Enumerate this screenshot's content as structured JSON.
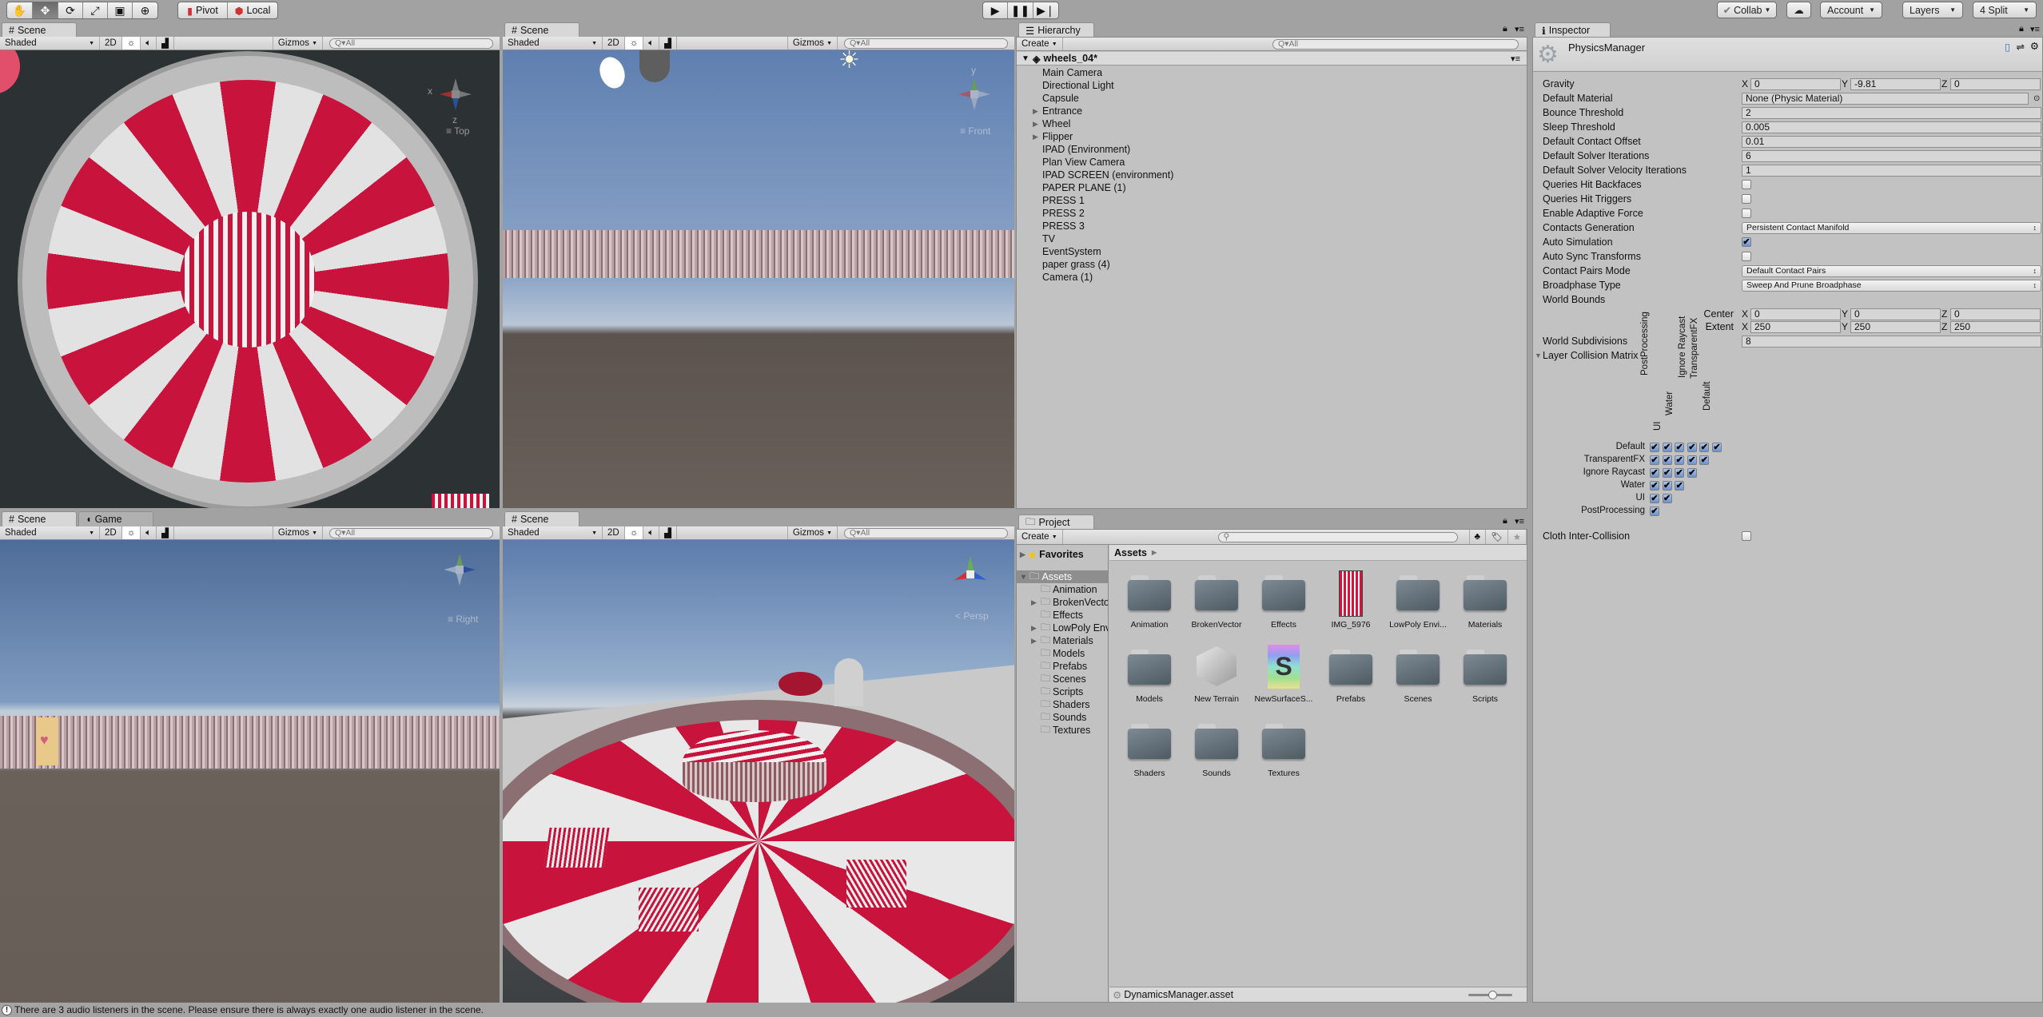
{
  "toolbar": {
    "tools": [
      "hand-icon",
      "move-icon",
      "rotate-icon",
      "scale-icon",
      "rect-icon",
      "transform-icon"
    ],
    "pivot_label": "Pivot",
    "local_label": "Local",
    "collab_label": "Collab",
    "account_label": "Account",
    "layers_label": "Layers",
    "layout_label": "4 Split"
  },
  "views": {
    "scene_tab": "Scene",
    "game_tab": "Game",
    "shading": "Shaded",
    "mode_2d": "2D",
    "gizmos": "Gizmos",
    "search_placeholder": "All",
    "top_left_orientation": "Top",
    "top_right_orientation": "Front",
    "bottom_left_orientation": "Right",
    "bottom_right_orientation": "Persp",
    "axis_x": "x",
    "axis_y": "y",
    "axis_z": "z"
  },
  "hierarchy": {
    "tab": "Hierarchy",
    "create": "Create",
    "search_placeholder": "All",
    "scene_name": "wheels_04*",
    "items": [
      {
        "label": "Main Camera",
        "expandable": false
      },
      {
        "label": "Directional Light",
        "expandable": false
      },
      {
        "label": "Capsule",
        "expandable": false
      },
      {
        "label": "Entrance",
        "expandable": true
      },
      {
        "label": "Wheel",
        "expandable": true
      },
      {
        "label": "Flipper",
        "expandable": true
      },
      {
        "label": "IPAD (Environment)",
        "expandable": false
      },
      {
        "label": "Plan View Camera",
        "expandable": false
      },
      {
        "label": "IPAD SCREEN (environment)",
        "expandable": false
      },
      {
        "label": "PAPER PLANE (1)",
        "expandable": false
      },
      {
        "label": "PRESS 1",
        "expandable": false
      },
      {
        "label": "PRESS 2",
        "expandable": false
      },
      {
        "label": "PRESS 3",
        "expandable": false
      },
      {
        "label": "TV",
        "expandable": false
      },
      {
        "label": "EventSystem",
        "expandable": false
      },
      {
        "label": "paper grass (4)",
        "expandable": false
      },
      {
        "label": "Camera (1)",
        "expandable": false
      }
    ]
  },
  "inspector": {
    "tab": "Inspector",
    "title": "PhysicsManager",
    "gravity": {
      "label": "Gravity",
      "x": "0",
      "y": "-9.81",
      "z": "0"
    },
    "fields": [
      {
        "label": "Default Material",
        "type": "object",
        "value": "None (Physic Material)"
      },
      {
        "label": "Bounce Threshold",
        "type": "text",
        "value": "2"
      },
      {
        "label": "Sleep Threshold",
        "type": "text",
        "value": "0.005"
      },
      {
        "label": "Default Contact Offset",
        "type": "text",
        "value": "0.01"
      },
      {
        "label": "Default Solver Iterations",
        "type": "text",
        "value": "6"
      },
      {
        "label": "Default Solver Velocity Iterations",
        "type": "text",
        "value": "1"
      },
      {
        "label": "Queries Hit Backfaces",
        "type": "check",
        "value": false
      },
      {
        "label": "Queries Hit Triggers",
        "type": "check",
        "value": false
      },
      {
        "label": "Enable Adaptive Force",
        "type": "check",
        "value": false
      },
      {
        "label": "Contacts Generation",
        "type": "dropdown",
        "value": "Persistent Contact Manifold"
      },
      {
        "label": "Auto Simulation",
        "type": "check",
        "value": true
      },
      {
        "label": "Auto Sync Transforms",
        "type": "check",
        "value": false
      },
      {
        "label": "Contact Pairs Mode",
        "type": "dropdown",
        "value": "Default Contact Pairs"
      },
      {
        "label": "Broadphase Type",
        "type": "dropdown",
        "value": "Sweep And Prune Broadphase"
      },
      {
        "label": "World Bounds",
        "type": "none",
        "value": ""
      }
    ],
    "center": {
      "label": "Center",
      "x": "0",
      "y": "0",
      "z": "0"
    },
    "extent": {
      "label": "Extent",
      "x": "250",
      "y": "250",
      "z": "250"
    },
    "world_subdivisions": {
      "label": "World Subdivisions",
      "value": "8"
    },
    "matrix_label": "Layer Collision Matrix",
    "layers": [
      "Default",
      "TransparentFX",
      "Ignore Raycast",
      "Water",
      "UI",
      "PostProcessing"
    ],
    "cloth": {
      "label": "Cloth Inter-Collision",
      "value": false
    },
    "axis": {
      "x": "X",
      "y": "Y",
      "z": "Z"
    }
  },
  "project": {
    "tab": "Project",
    "create": "Create",
    "favorites": "Favorites",
    "assets_root": "Assets",
    "breadcrumb": "Assets",
    "tree": [
      {
        "label": "Animation",
        "expandable": false
      },
      {
        "label": "BrokenVecto",
        "expandable": true
      },
      {
        "label": "Effects",
        "expandable": false
      },
      {
        "label": "LowPoly Env",
        "expandable": true
      },
      {
        "label": "Materials",
        "expandable": true
      },
      {
        "label": "Models",
        "expandable": false
      },
      {
        "label": "Prefabs",
        "expandable": false
      },
      {
        "label": "Scenes",
        "expandable": false
      },
      {
        "label": "Scripts",
        "expandable": false
      },
      {
        "label": "Shaders",
        "expandable": false
      },
      {
        "label": "Sounds",
        "expandable": false
      },
      {
        "label": "Textures",
        "expandable": false
      }
    ],
    "items": [
      {
        "label": "Animation",
        "kind": "folder"
      },
      {
        "label": "BrokenVector",
        "kind": "folder"
      },
      {
        "label": "Effects",
        "kind": "folder"
      },
      {
        "label": "IMG_5976",
        "kind": "texture"
      },
      {
        "label": "LowPoly Envi...",
        "kind": "folder"
      },
      {
        "label": "Materials",
        "kind": "folder"
      },
      {
        "label": "Models",
        "kind": "folder"
      },
      {
        "label": "New Terrain",
        "kind": "terrain"
      },
      {
        "label": "NewSurfaceS...",
        "kind": "shader"
      },
      {
        "label": "Prefabs",
        "kind": "folder"
      },
      {
        "label": "Scenes",
        "kind": "folder"
      },
      {
        "label": "Scripts",
        "kind": "folder"
      },
      {
        "label": "Shaders",
        "kind": "folder"
      },
      {
        "label": "Sounds",
        "kind": "folder"
      },
      {
        "label": "Textures",
        "kind": "folder"
      }
    ],
    "footer_file": "DynamicsManager.asset",
    "icon_size": 0.55
  },
  "status": {
    "message": "There are 3 audio listeners in the scene. Please ensure there is always exactly one audio listener in the scene."
  },
  "colors": {
    "accent_red": "#c8143c",
    "wedge_light": "#e2e2e2",
    "sky": "#6b8cbc",
    "selection": "#8e8e8e"
  }
}
